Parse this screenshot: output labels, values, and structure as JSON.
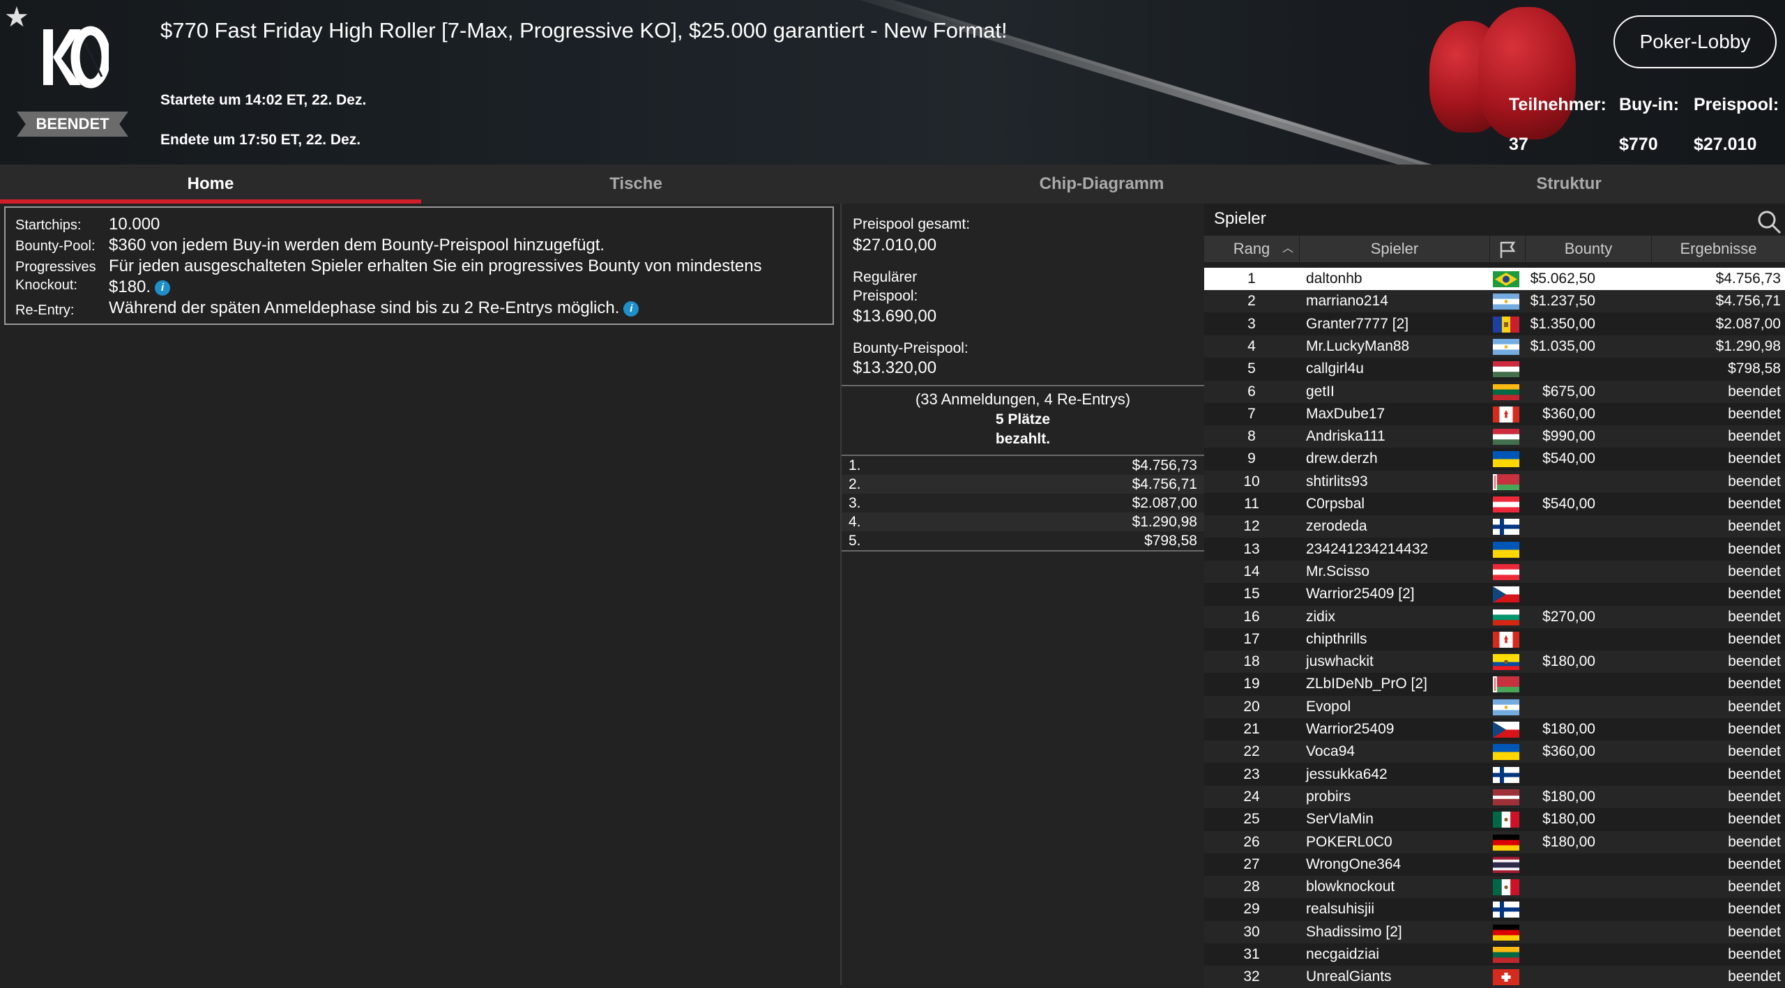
{
  "header": {
    "status": "BEENDET",
    "title": "$770 Fast Friday High Roller [7-Max, Progressive KO], $25.000 garantiert - New Format!",
    "start": "Startete um 14:02 ET, 22. Dez.",
    "end": "Endete um 17:50 ET, 22. Dez.",
    "lobby_button": "Poker-Lobby",
    "stats": {
      "participants_label": "Teilnehmer:",
      "participants": "37",
      "buyin_label": "Buy-in:",
      "buyin": "$770",
      "prizepool_label": "Preispool:",
      "prizepool": "$27.010"
    }
  },
  "tabs": [
    {
      "label": "Home",
      "active": true
    },
    {
      "label": "Tische"
    },
    {
      "label": "Chip-Diagramm"
    },
    {
      "label": "Struktur"
    }
  ],
  "info": {
    "startchips_label": "Startchips:",
    "startchips": "10.000",
    "bountypool_label": "Bounty-Pool:",
    "bountypool": "$360 von jedem Buy-in werden dem Bounty-Preispool hinzugefügt.",
    "pko_label1": "Progressives",
    "pko_label2": "Knockout:",
    "pko_line1": "Für jeden ausgeschalteten Spieler erhalten Sie ein progressives Bounty von mindestens",
    "pko_line2": "$180.",
    "reentry_label": "Re-Entry:",
    "reentry": "Während der späten Anmeldephase sind bis zu 2 Re-Entrys möglich.",
    "info_glyph": "i"
  },
  "prizepool": {
    "total_label": "Preispool gesamt:",
    "total": "$27.010,00",
    "regular_label1": "Regulärer",
    "regular_label2": "Preispool:",
    "regular": "$13.690,00",
    "bounty_label": "Bounty-Preispool:",
    "bounty": "$13.320,00",
    "entries_note": "(33 Anmeldungen, 4 Re-Entrys)",
    "paid_line1": "5 Plätze",
    "paid_line2": "bezahlt.",
    "payouts": [
      {
        "place": "1.",
        "amount": "$4.756,73"
      },
      {
        "place": "2.",
        "amount": "$4.756,71"
      },
      {
        "place": "3.",
        "amount": "$2.087,00"
      },
      {
        "place": "4.",
        "amount": "$1.290,98"
      },
      {
        "place": "5.",
        "amount": "$798,58"
      }
    ]
  },
  "players": {
    "title": "Spieler",
    "columns": {
      "rank": "Rang",
      "name": "Spieler",
      "bounty": "Bounty",
      "result": "Ergebnisse"
    },
    "rows": [
      {
        "rank": "1",
        "name": "daltonhb",
        "flag": "brazil",
        "bounty": "$5.062,50",
        "result": "$4.756,73"
      },
      {
        "rank": "2",
        "name": "marriano214",
        "flag": "argentina",
        "bounty": "$1.237,50",
        "result": "$4.756,71"
      },
      {
        "rank": "3",
        "name": "Granter7777 [2]",
        "flag": "moldova",
        "bounty": "$1.350,00",
        "result": "$2.087,00"
      },
      {
        "rank": "4",
        "name": "Mr.LuckyMan88",
        "flag": "argentina",
        "bounty": "$1.035,00",
        "result": "$1.290,98"
      },
      {
        "rank": "5",
        "name": "callgirl4u",
        "flag": "hungary",
        "bounty": "",
        "result": "$798,58"
      },
      {
        "rank": "6",
        "name": "getII",
        "flag": "lithuania",
        "bounty": "$675,00",
        "result": "beendet"
      },
      {
        "rank": "7",
        "name": "MaxDube17",
        "flag": "canada",
        "bounty": "$360,00",
        "result": "beendet"
      },
      {
        "rank": "8",
        "name": "Andriska111",
        "flag": "hungary",
        "bounty": "$990,00",
        "result": "beendet"
      },
      {
        "rank": "9",
        "name": "drew.derzh",
        "flag": "ukraine",
        "bounty": "$540,00",
        "result": "beendet"
      },
      {
        "rank": "10",
        "name": "shtirlits93",
        "flag": "belarus",
        "bounty": "",
        "result": "beendet"
      },
      {
        "rank": "11",
        "name": "C0rpsbal",
        "flag": "austria",
        "bounty": "$540,00",
        "result": "beendet"
      },
      {
        "rank": "12",
        "name": "zerodeda",
        "flag": "finland",
        "bounty": "",
        "result": "beendet"
      },
      {
        "rank": "13",
        "name": "234241234214432",
        "flag": "ukraine",
        "bounty": "",
        "result": "beendet"
      },
      {
        "rank": "14",
        "name": "Mr.Scisso",
        "flag": "austria",
        "bounty": "",
        "result": "beendet"
      },
      {
        "rank": "15",
        "name": "Warrior25409 [2]",
        "flag": "czechia",
        "bounty": "",
        "result": "beendet"
      },
      {
        "rank": "16",
        "name": "zidix",
        "flag": "bulgaria",
        "bounty": "$270,00",
        "result": "beendet"
      },
      {
        "rank": "17",
        "name": "chipthrills",
        "flag": "canada",
        "bounty": "",
        "result": "beendet"
      },
      {
        "rank": "18",
        "name": "juswhackit",
        "flag": "ecuador",
        "bounty": "$180,00",
        "result": "beendet"
      },
      {
        "rank": "19",
        "name": "ZLbIDeNb_PrO [2]",
        "flag": "belarus",
        "bounty": "",
        "result": "beendet"
      },
      {
        "rank": "20",
        "name": "Evopol",
        "flag": "argentina",
        "bounty": "",
        "result": "beendet"
      },
      {
        "rank": "21",
        "name": "Warrior25409",
        "flag": "czechia",
        "bounty": "$180,00",
        "result": "beendet"
      },
      {
        "rank": "22",
        "name": "Voca94",
        "flag": "ukraine",
        "bounty": "$360,00",
        "result": "beendet"
      },
      {
        "rank": "23",
        "name": "jessukka642",
        "flag": "finland",
        "bounty": "",
        "result": "beendet"
      },
      {
        "rank": "24",
        "name": "probirs",
        "flag": "latvia",
        "bounty": "$180,00",
        "result": "beendet"
      },
      {
        "rank": "25",
        "name": "SerVlaMin",
        "flag": "mexico",
        "bounty": "$180,00",
        "result": "beendet"
      },
      {
        "rank": "26",
        "name": "POKERL0C0",
        "flag": "germany",
        "bounty": "$180,00",
        "result": "beendet"
      },
      {
        "rank": "27",
        "name": "WrongOne364",
        "flag": "thailand",
        "bounty": "",
        "result": "beendet"
      },
      {
        "rank": "28",
        "name": "blowknockout",
        "flag": "mexico",
        "bounty": "",
        "result": "beendet"
      },
      {
        "rank": "29",
        "name": "realsuhisjii",
        "flag": "finland",
        "bounty": "",
        "result": "beendet"
      },
      {
        "rank": "30",
        "name": "Shadissimo [2]",
        "flag": "germany",
        "bounty": "",
        "result": "beendet"
      },
      {
        "rank": "31",
        "name": "necgaidziai",
        "flag": "lithuania",
        "bounty": "",
        "result": "beendet"
      },
      {
        "rank": "32",
        "name": "UnrealGiants",
        "flag": "switzerland",
        "bounty": "",
        "result": "beendet"
      }
    ]
  },
  "colors": {
    "accent": "#d11f2a",
    "info_dot": "#1f8fc9",
    "background": "#222222"
  }
}
